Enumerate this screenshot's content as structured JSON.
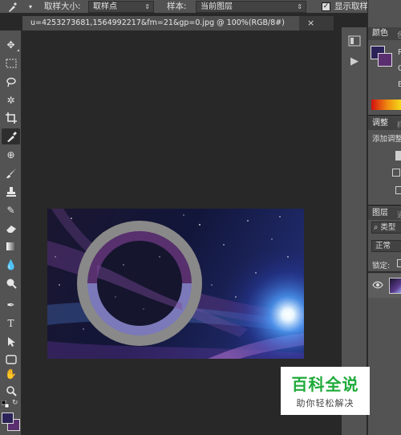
{
  "options_bar": {
    "tool_arrow": "▾",
    "sample_size_label": "取样大小:",
    "sample_size_value": "取样点",
    "sample_label": "样本:",
    "sample_value": "当前图层",
    "show_ring_checked": "✓",
    "show_ring_label": "显示取样环"
  },
  "document": {
    "tab_title": "u=4253273681,1564992217&fm=21&gp=0.jpg @ 100%(RGB/8#)",
    "close_glyph": "×"
  },
  "panels": {
    "color_tab": "颜色",
    "color_tab2": "色",
    "channel_r": "R",
    "channel_g": "G",
    "channel_b": "B",
    "adjust_tab": "调整",
    "adjust_tab2": "样",
    "add_adjust": "添加调整",
    "layers_tab": "图层",
    "layers_tab2": "通",
    "filter_kind": "类型",
    "blend_mode": "正常",
    "lock_label": "锁定:"
  },
  "colors": {
    "foreground": "#2b2357",
    "background": "#5b2f6f",
    "ring_outer": "#8a8a8a",
    "ring_top": "#57306d",
    "ring_bottom": "#7b79b9"
  },
  "watermark": {
    "title": "百科全说",
    "subtitle": "助你轻松解决"
  }
}
